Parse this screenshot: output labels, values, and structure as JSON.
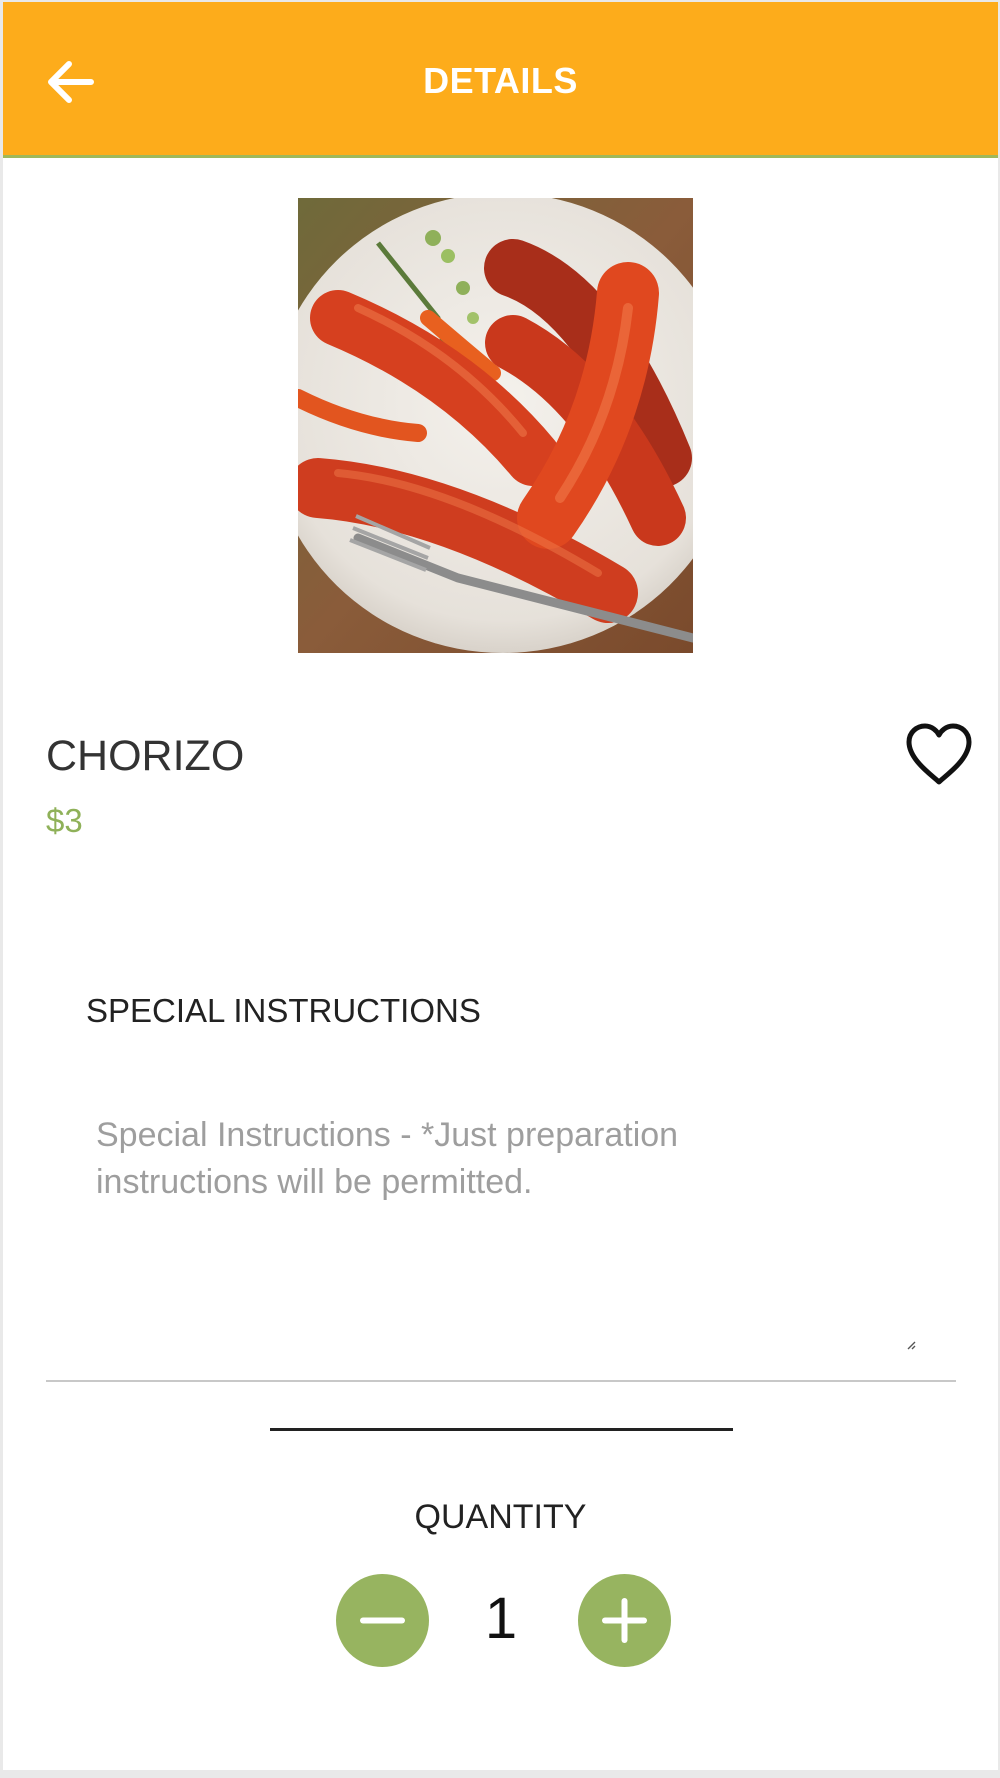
{
  "appbar": {
    "title": "DETAILS",
    "back_icon": "arrow-left-icon",
    "color": "#fdac1b"
  },
  "product": {
    "name": "CHORIZO",
    "price": "$3",
    "price_color": "#8fb159",
    "favorite_icon": "heart-outline-icon",
    "favorited": false
  },
  "instructions": {
    "label": "SPECIAL INSTRUCTIONS",
    "placeholder": "Special Instructions - *Just preparation instructions will be permitted.",
    "value": ""
  },
  "quantity": {
    "label": "QUANTITY",
    "value": "1",
    "minus_icon": "minus-icon",
    "plus_icon": "plus-icon",
    "button_color": "#97b460"
  }
}
